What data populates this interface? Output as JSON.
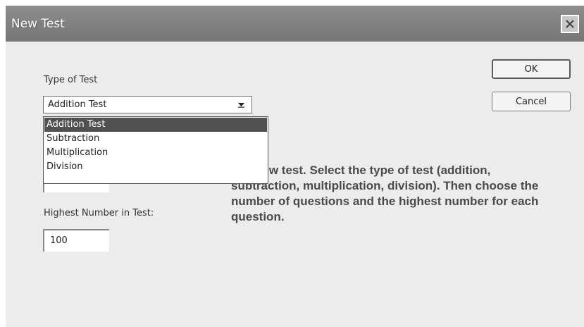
{
  "window": {
    "title": "New Test"
  },
  "buttons": {
    "ok_label": "OK",
    "cancel_label": "Cancel"
  },
  "type_of_test": {
    "label": "Type of Test",
    "selected_value": "Addition Test",
    "options": [
      "Addition Test",
      "Subtraction",
      "Multiplication",
      "Division"
    ]
  },
  "highest_number": {
    "label": "Highest Number in Test:",
    "value": "100"
  },
  "instructions": {
    "visible_text": "te a new test.  Select the type of test (addition, subtraction, multiplication, division).  Then choose the number of questions and the highest number for each question."
  },
  "icons": {
    "close": "close-icon",
    "dropdown_arrow": "chevron-down-icon"
  },
  "colors": {
    "titlebar": "#828282",
    "dialog_background": "#ececec",
    "selected_option": "#505050"
  }
}
